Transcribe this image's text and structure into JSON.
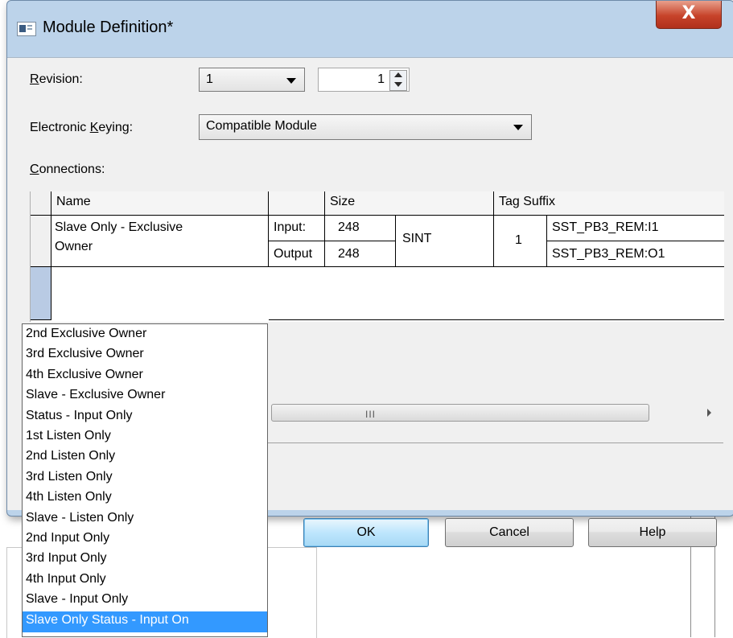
{
  "window": {
    "title": "Module Definition*",
    "close_label": "X"
  },
  "revision": {
    "label_prefix": "",
    "label_underline": "R",
    "label_rest": "evision:",
    "major": "1",
    "minor": "1"
  },
  "keying": {
    "label_prefix": "Electronic ",
    "label_underline": "K",
    "label_rest": "eying:",
    "value": "Compatible Module"
  },
  "connections": {
    "label_underline": "C",
    "label_rest": "onnections:",
    "headers": {
      "name": "Name",
      "size": "Size",
      "tag_suffix": "Tag Suffix"
    },
    "row": {
      "name_line1": "Slave Only - Exclusive",
      "name_line2": "Owner",
      "input_label": "Input:",
      "output_label": "Output",
      "input_size": "248",
      "output_size": "248",
      "type": "SINT",
      "rpi": "1",
      "input_tag": "SST_PB3_REM:I1",
      "output_tag": "SST_PB3_REM:O1"
    },
    "new_row_value": "",
    "dropdown_options": [
      "2nd Exclusive Owner",
      "3rd Exclusive Owner",
      "4th Exclusive Owner",
      "Slave - Exclusive Owner",
      "Status - Input Only",
      "1st Listen Only",
      "2nd Listen Only",
      "3rd Listen Only",
      "4th Listen Only",
      "Slave - Listen Only",
      "2nd Input Only",
      "3rd Input Only",
      "4th Input Only",
      "Slave - Input Only",
      "Slave Only Status - Input On"
    ],
    "selected_option_index": 14,
    "scroll_grip": "III"
  },
  "buttons": {
    "ok": "OK",
    "cancel": "Cancel",
    "help": "Help"
  },
  "colors": {
    "selection": "#3399ff",
    "title_bar": "#bcd3ea",
    "close_button": "#c7432a"
  },
  "icons": {
    "window": "module-window-icon",
    "close": "close-icon",
    "dropdown": "chevron-down-icon",
    "spin": "spin-arrows-icon"
  }
}
